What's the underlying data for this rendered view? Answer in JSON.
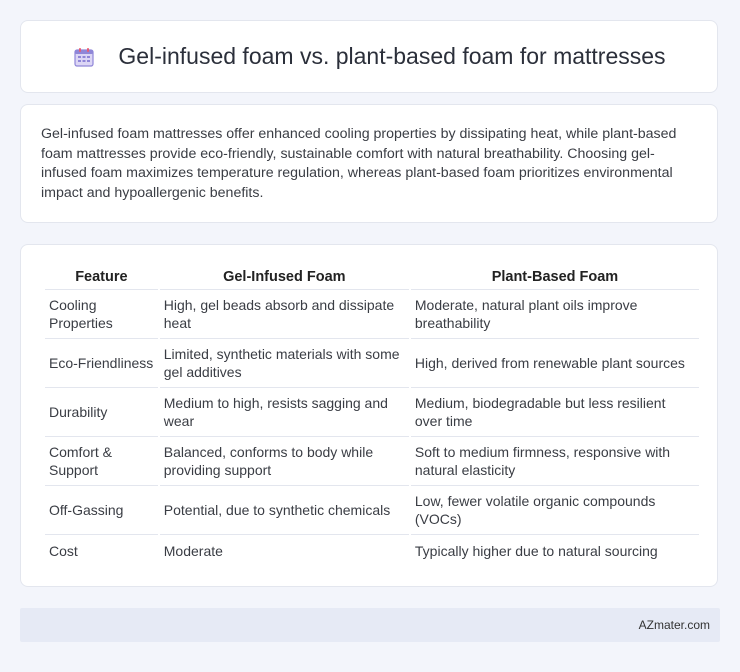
{
  "header": {
    "title": "Gel-infused foam vs. plant-based foam for mattresses",
    "icon": "calendar-icon"
  },
  "intro": {
    "text": "Gel-infused foam mattresses offer enhanced cooling properties by dissipating heat, while plant-based foam mattresses provide eco-friendly, sustainable comfort with natural breathability. Choosing gel-infused foam maximizes temperature regulation, whereas plant-based foam prioritizes environmental impact and hypoallergenic benefits."
  },
  "table": {
    "headers": [
      "Feature",
      "Gel-Infused Foam",
      "Plant-Based Foam"
    ],
    "rows": [
      [
        "Cooling Properties",
        "High, gel beads absorb and dissipate heat",
        "Moderate, natural plant oils improve breathability"
      ],
      [
        "Eco-Friendliness",
        "Limited, synthetic materials with some gel additives",
        "High, derived from renewable plant sources"
      ],
      [
        "Durability",
        "Medium to high, resists sagging and wear",
        "Medium, biodegradable but less resilient over time"
      ],
      [
        "Comfort & Support",
        "Balanced, conforms to body while providing support",
        "Soft to medium firmness, responsive with natural elasticity"
      ],
      [
        "Off-Gassing",
        "Potential, due to synthetic chemicals",
        "Low, fewer volatile organic compounds (VOCs)"
      ],
      [
        "Cost",
        "Moderate",
        "Typically higher due to natural sourcing"
      ]
    ]
  },
  "footer": {
    "text": "AZmater.com"
  }
}
